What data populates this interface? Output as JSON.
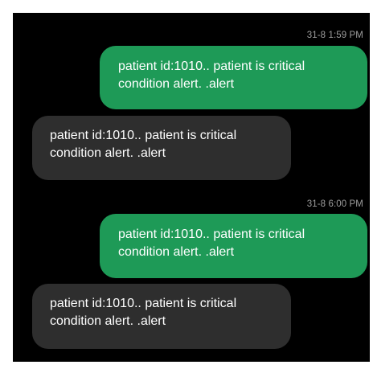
{
  "conversation": {
    "messages": [
      {
        "direction": "outgoing",
        "timestamp": "31-8 1:59 PM",
        "text": "patient id:1010.. patient is critical\ncondition alert. .alert"
      },
      {
        "direction": "incoming",
        "text": "patient id:1010.. patient is critical\ncondition alert. .alert"
      },
      {
        "direction": "outgoing",
        "timestamp": "31-8 6:00 PM",
        "text": "patient id:1010.. patient is critical\ncondition alert. .alert"
      },
      {
        "direction": "incoming",
        "text": "patient id:1010.. patient is critical\ncondition alert. .alert"
      }
    ]
  },
  "colors": {
    "background": "#000000",
    "outgoing_bubble": "#1e9a57",
    "incoming_bubble": "#2e2e2e",
    "timestamp_text": "#9e9e9e",
    "message_text": "#ffffff"
  }
}
